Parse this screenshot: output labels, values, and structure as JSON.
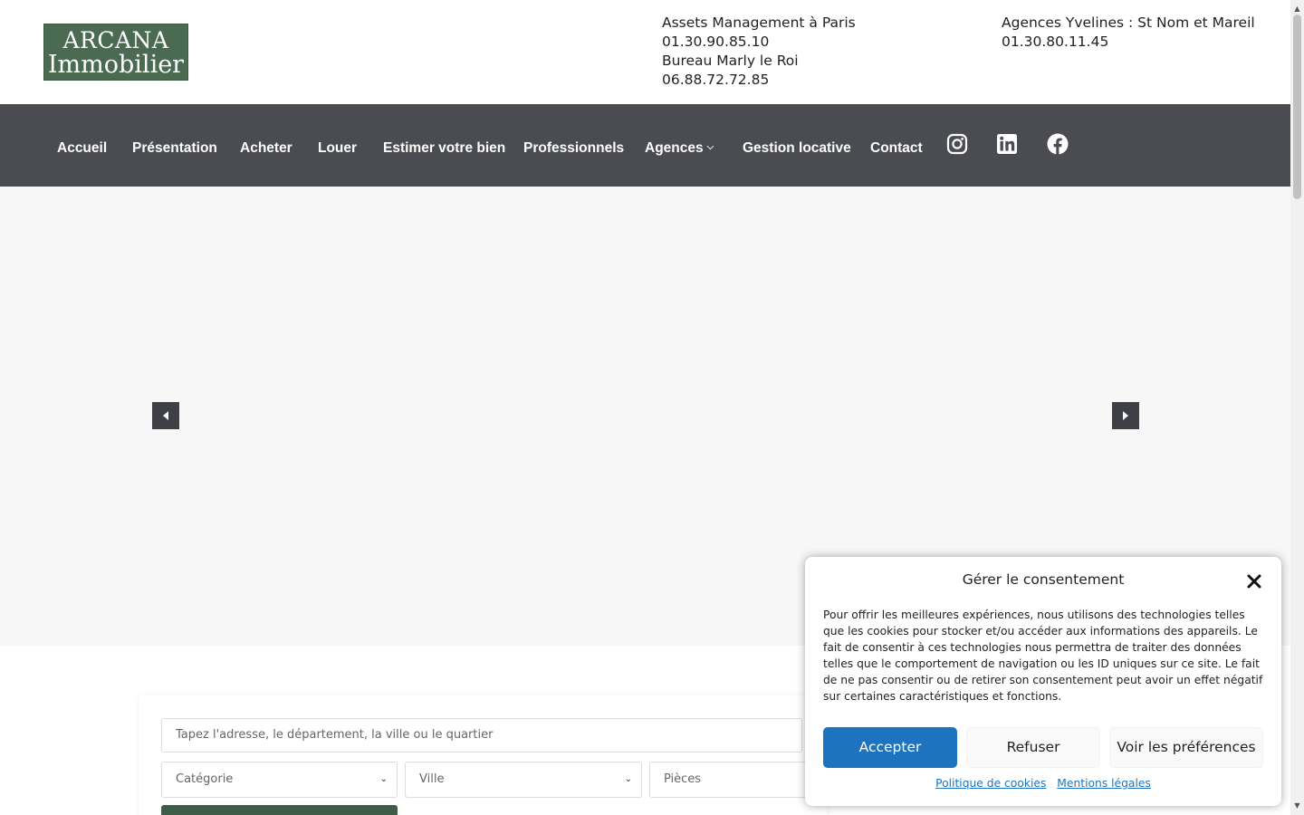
{
  "logo": {
    "line1": "ARCANA",
    "line2": "Immobilier"
  },
  "contacts": {
    "left": [
      "Assets Management à Paris",
      "01.30.90.85.10",
      "Bureau Marly le Roi",
      "06.88.72.72.85"
    ],
    "right": [
      "Agences Yvelines : St Nom et Mareil",
      "01.30.80.11.45"
    ]
  },
  "nav": {
    "items": [
      "Accueil",
      "Présentation",
      "Acheter",
      "Louer",
      "Estimer votre bien",
      "Professionnels",
      "Agences",
      "Gestion locative",
      "Contact"
    ],
    "agences_chevron": "⌵",
    "social_icons": [
      "instagram-icon",
      "linkedin-icon",
      "facebook-icon"
    ]
  },
  "slider": {
    "prev_icon": "triangle-left-icon",
    "next_icon": "triangle-right-icon"
  },
  "search": {
    "placeholder": "Tapez l'adresse, le département, la ville ou le quartier",
    "category": "Catégorie",
    "city": "Ville",
    "rooms": "Pièces",
    "caret": "⌄"
  },
  "cookie": {
    "title": "Gérer le consentement",
    "text": "Pour offrir les meilleures expériences, nous utilisons des technologies telles que les cookies pour stocker et/ou accéder aux informations des appareils. Le fait de consentir à ces technologies nous permettra de traiter des données telles que le comportement de navigation ou les ID uniques sur ce site. Le fait de ne pas consentir ou de retirer son consentement peut avoir un effet négatif sur certaines caractéristiques et fonctions.",
    "accept": "Accepter",
    "refuse": "Refuser",
    "preferences": "Voir les préférences",
    "link_cookies": "Politique de cookies",
    "link_legal": "Mentions légales"
  },
  "colors": {
    "brand_green": "#4a6b52",
    "nav_bg": "#4a4c51",
    "accept_blue": "#1e73be"
  }
}
